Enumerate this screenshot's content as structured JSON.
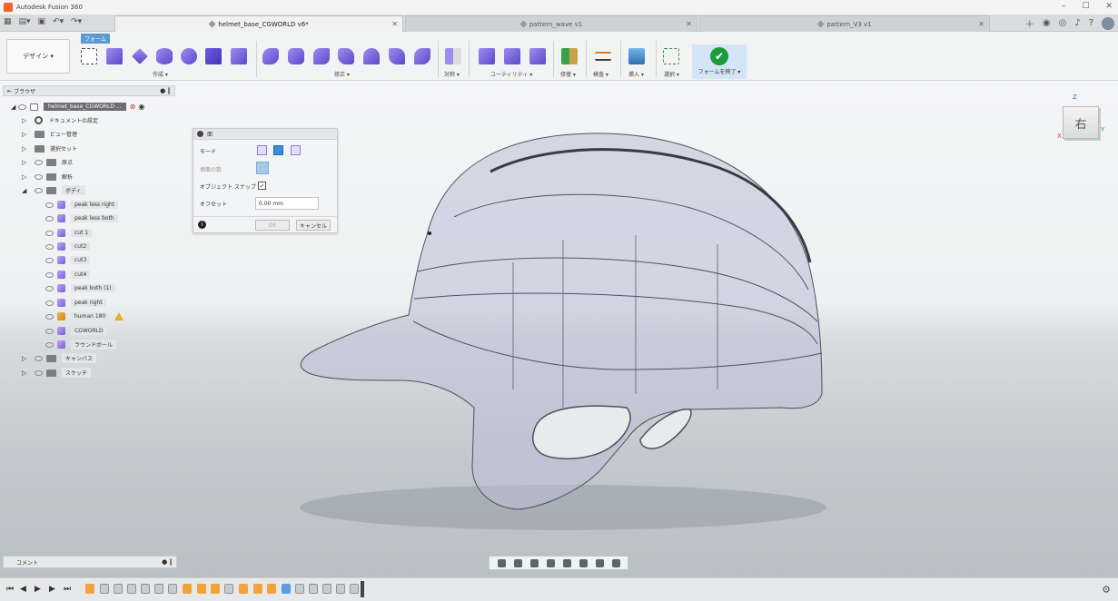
{
  "window": {
    "app_title": "Autodesk Fusion 360",
    "minimize": "–",
    "maximize": "☐",
    "close": "✕"
  },
  "tabs": [
    {
      "label": "helmet_base_CGWORLD v6*",
      "active": true
    },
    {
      "label": "pattern_wave v1",
      "active": false
    },
    {
      "label": "pattern_V3 v1",
      "active": false
    }
  ],
  "toolbar": {
    "workspace": "デザイン ▾",
    "form_tab": "フォーム",
    "groups": {
      "create": "作成 ▾",
      "modify": "修正 ▾",
      "symmetry": "対称 ▾",
      "utility": "ユーティリティ ▾",
      "repair": "修復 ▾",
      "inspect": "検査 ▾",
      "insert": "挿入 ▾",
      "select": "選択 ▾"
    },
    "finish": "フォームを終了 ▾"
  },
  "browser": {
    "header": "ブラウザ",
    "root": "helmet_base_CGWORLD ...",
    "items": [
      {
        "label": "ドキュメントの設定"
      },
      {
        "label": "ビュー管理"
      },
      {
        "label": "選択セット"
      },
      {
        "label": "原点"
      },
      {
        "label": "解析"
      },
      {
        "label": "ボディ"
      }
    ],
    "bodies": [
      {
        "label": "peak less right"
      },
      {
        "label": "peak less both"
      },
      {
        "label": "cut 1"
      },
      {
        "label": "cut2"
      },
      {
        "label": "cut3"
      },
      {
        "label": "cut4"
      },
      {
        "label": "peak both (1)"
      },
      {
        "label": "peak right"
      },
      {
        "label": "human 180"
      },
      {
        "label": "CGWORLD"
      },
      {
        "label": "ラウンドボール"
      }
    ],
    "after": [
      {
        "label": "キャンバス"
      },
      {
        "label": "スケッチ"
      }
    ]
  },
  "dialog": {
    "title": "面",
    "mode_label": "モード",
    "sides_label": "側面の数",
    "snap_label": "オブジェクト スナップ",
    "offset_label": "オフセット",
    "offset_value": "0.00 mm",
    "ok": "OK",
    "cancel": "キャンセル"
  },
  "viewcube": {
    "face": "右",
    "z": "Z",
    "x": "X",
    "y": "Y"
  },
  "comments": {
    "label": "コメント"
  },
  "colors": {
    "accent": "#2b7bd6",
    "finish_green": "#1a9c3b",
    "body_purple": "#7a5ed8"
  }
}
